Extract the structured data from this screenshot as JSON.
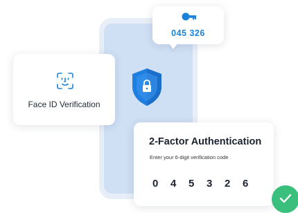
{
  "code_bubble": {
    "icon": "key-icon",
    "code": "045 326",
    "accent": "#1a82d8"
  },
  "face_card": {
    "icon": "face-id-icon",
    "label": "Face ID Verification"
  },
  "shield": {
    "icon": "shield-lock-icon",
    "color": "#1f7fe0"
  },
  "auth_card": {
    "title": "2-Factor Authentication",
    "subtitle": "Enter your 6-digit verification code",
    "digits": [
      "0",
      "4",
      "5",
      "3",
      "2",
      "6"
    ]
  },
  "check_badge": {
    "icon": "check-icon",
    "color": "#3bbf7c"
  }
}
